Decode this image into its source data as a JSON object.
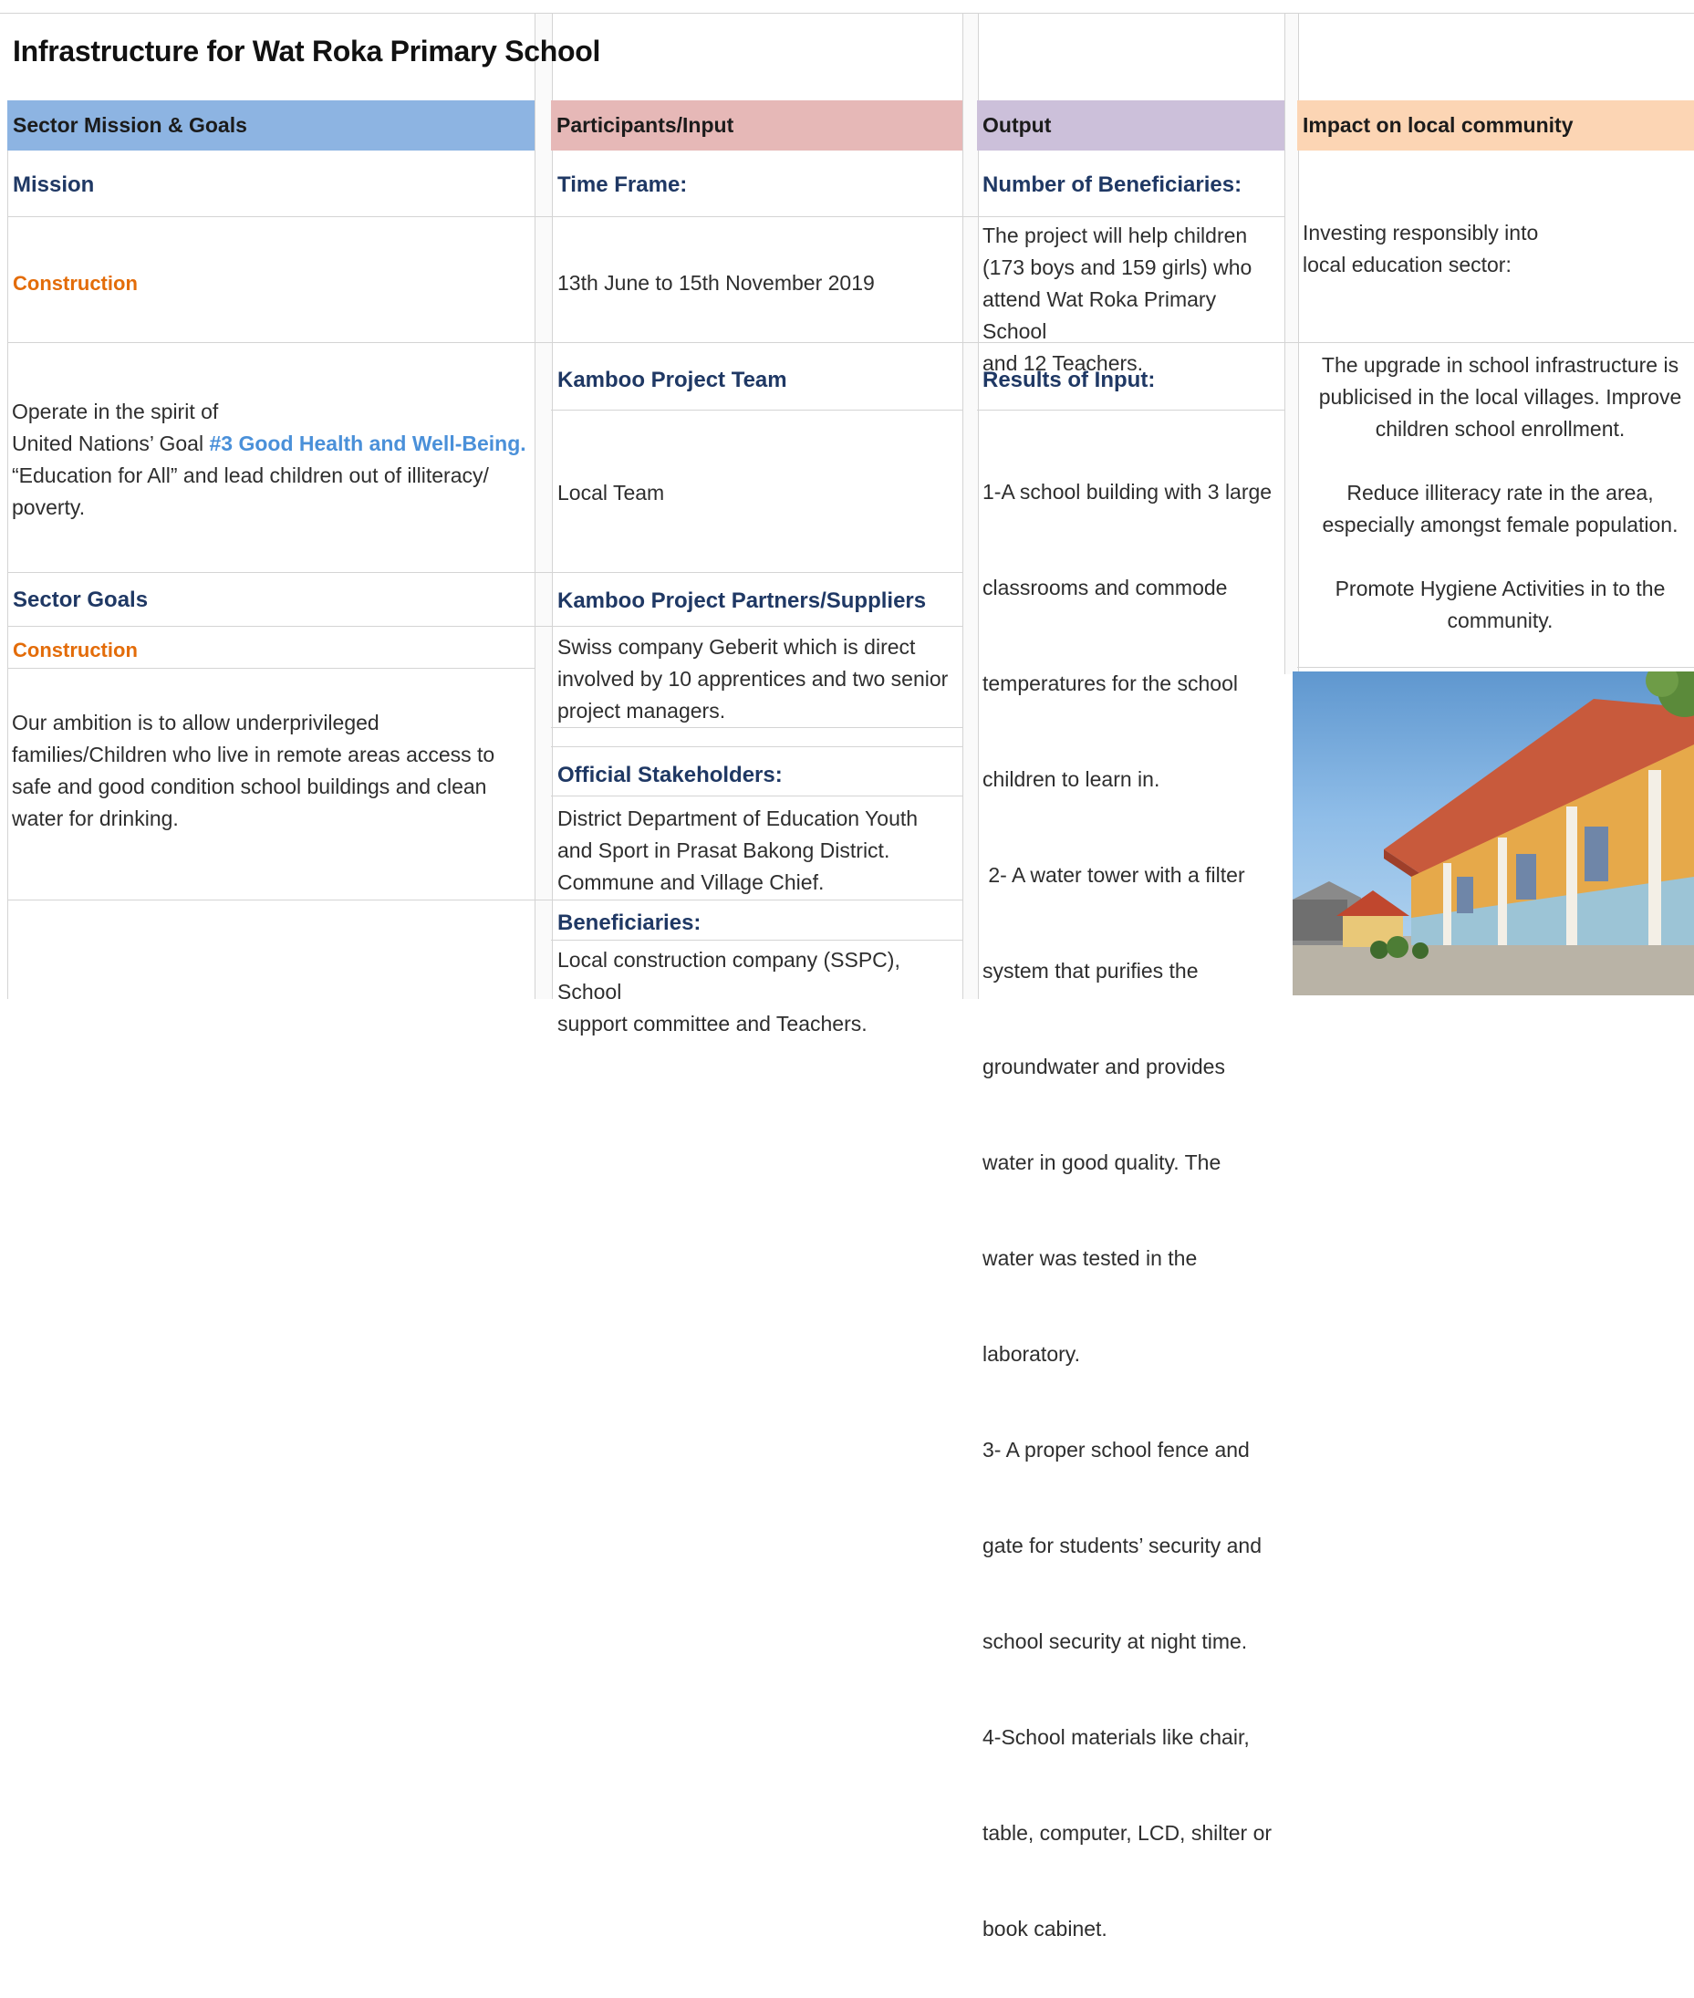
{
  "title": "Infrastructure for Wat Roka Primary School",
  "headers": {
    "sector": "Sector Mission & Goals",
    "participants": "Participants/Input",
    "output": "Output",
    "impact": "Impact on local community"
  },
  "colors": {
    "sector_header": "#8db4e2",
    "participants_header": "#e6b8b7",
    "output_header": "#ccc0da",
    "impact_header": "#fcd5b4",
    "label_navy": "#1f3864",
    "orange": "#e36c09",
    "link_blue": "#4a90d9"
  },
  "sector": {
    "mission_label": "Mission",
    "construction_1": "Construction",
    "spirit": [
      "Operate in the spirit of"
    ],
    "un_goal_prefix": "United Nations’ Goal ",
    "un_goal_link": "#3 Good Health and Well-Being.",
    "spirit_rest": [
      "“Education for All” and lead children out of illiteracy/",
      "poverty."
    ],
    "goals_label": "Sector Goals",
    "construction_2": "Construction",
    "ambition": [
      "Our ambition is to allow underprivileged",
      "families/Children who live in remote areas access to",
      "safe and good condition school buildings and clean",
      "water for drinking."
    ]
  },
  "participants": {
    "time_frame_label": "Time Frame:",
    "time_frame": "13th June to 15th November 2019",
    "team_label": "Kamboo Project Team",
    "team": "Local Team",
    "partners_label": "Kamboo Project Partners/Suppliers",
    "partners": [
      "Swiss company Geberit which is direct",
      "involved by 10 apprentices and two senior",
      "project managers."
    ],
    "stakeholders_label": "Official Stakeholders:",
    "stakeholders": [
      "District Department of Education Youth",
      "and Sport in Prasat Bakong District.",
      "Commune and Village Chief."
    ],
    "beneficiaries_label": "Beneficiaries:",
    "beneficiaries": [
      "Local construction company (SSPC), School",
      "support committee and Teachers."
    ]
  },
  "output": {
    "num_label": "Number of Beneficiaries:",
    "num_text": [
      "The project will help children",
      "(173 boys and 159 girls) who",
      "attend Wat Roka Primary School",
      "and 12 Teachers."
    ],
    "results_label": "Results of Input:",
    "results": [
      "1-A school building with 3 large",
      "classrooms and commode",
      "temperatures for the school",
      "children to learn in.",
      " 2- A water tower with a filter",
      "system that purifies the",
      "groundwater and provides",
      "water in good quality. The",
      "water was tested in the",
      "laboratory.",
      "3- A proper school fence and",
      "gate for students’ security and",
      "school security at night time.",
      "4-School materials like chair,",
      "table, computer, LCD, shilter or",
      "book cabinet."
    ]
  },
  "impact": {
    "investing": [
      "Investing responsibly into",
      "local education sector:"
    ],
    "upgrade": [
      "The upgrade in school infrastructure is",
      "publicised in the local villages. Improve",
      "children school enrollment."
    ],
    "reduce": [
      "Reduce illiteracy rate in the area,",
      "especially amongst female population."
    ],
    "hygiene": [
      "Promote Hygiene Activities in to the",
      "community."
    ]
  }
}
